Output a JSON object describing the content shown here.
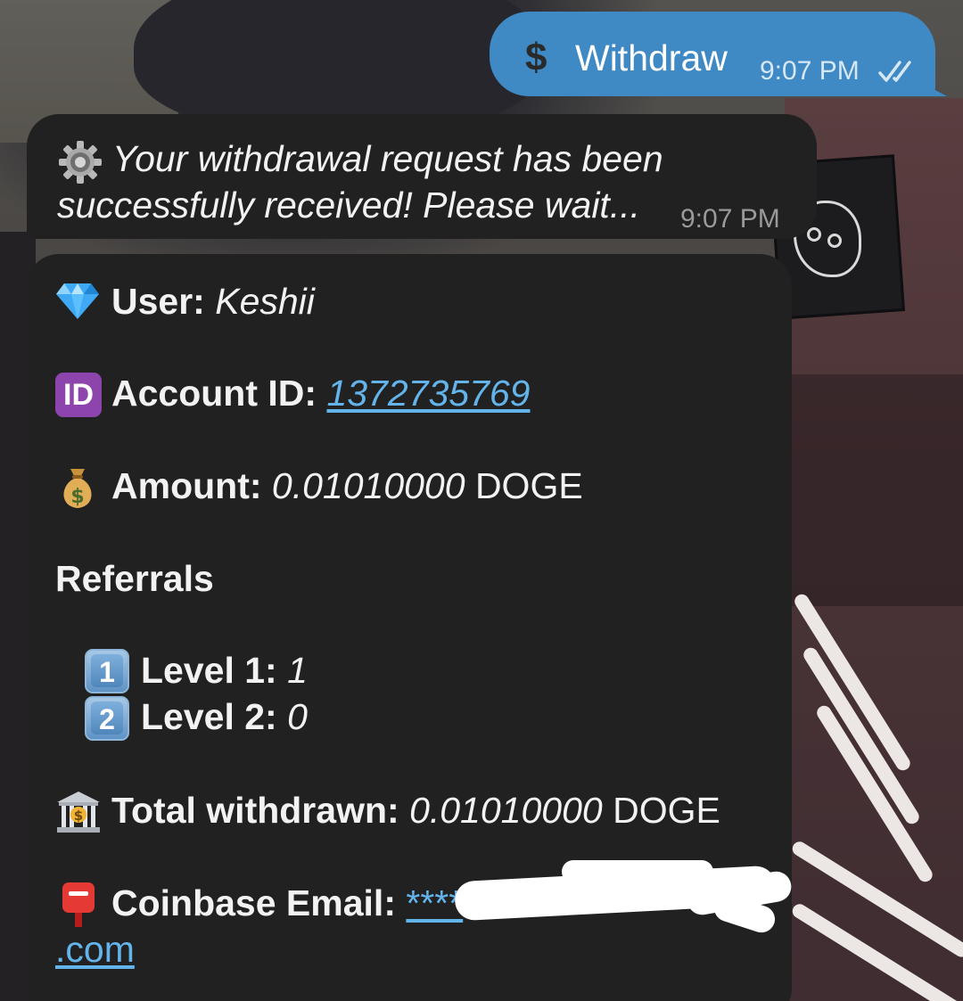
{
  "outgoing": {
    "icon": "dollar-icon",
    "icon_glyph": "$",
    "text": "Withdraw",
    "time": "9:07 PM",
    "status_icon": "double-check-icon"
  },
  "incoming_status": {
    "icon": "gear-icon",
    "line1": "Your withdrawal request has been",
    "line2": "successfully received! Please wait...",
    "time": "9:07 PM"
  },
  "details": {
    "user": {
      "icon": "gem-icon",
      "label": "User:",
      "value": "Keshii"
    },
    "account_id": {
      "icon": "id-icon",
      "icon_text": "ID",
      "label": "Account ID:",
      "value": "1372735769"
    },
    "amount": {
      "icon": "money-bag-icon",
      "label": "Amount:",
      "value": "0.01010000",
      "unit": "DOGE"
    },
    "referrals": {
      "heading": "Referrals",
      "level1": {
        "icon_text": "1",
        "label": "Level 1:",
        "value": "1"
      },
      "level2": {
        "icon_text": "2",
        "label": "Level 2:",
        "value": "0"
      }
    },
    "total": {
      "icon": "bank-icon",
      "label": "Total withdrawn:",
      "value": "0.01010000",
      "unit": "DOGE"
    },
    "email": {
      "icon": "postbox-icon",
      "label": "Coinbase Email:",
      "value_start": "****",
      "value_end": ".com"
    }
  },
  "colors": {
    "outgoing_bubble": "#3f89c4",
    "incoming_bubble": "#212121",
    "link": "#64b4ec"
  }
}
